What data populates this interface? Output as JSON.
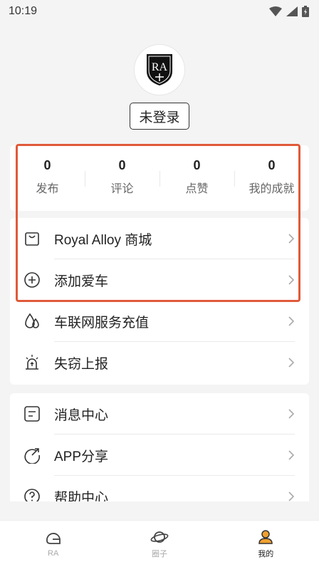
{
  "status_bar": {
    "time": "10:19"
  },
  "profile": {
    "avatar_text": "RA",
    "login_label": "未登录"
  },
  "stats": [
    {
      "value": "0",
      "label": "发布"
    },
    {
      "value": "0",
      "label": "评论"
    },
    {
      "value": "0",
      "label": "点赞"
    },
    {
      "value": "0",
      "label": "我的成就"
    }
  ],
  "menu_group_1": [
    {
      "label": "Royal Alloy 商城",
      "icon": "shopping-bag-icon"
    },
    {
      "label": "添加爱车",
      "icon": "add-circle-icon"
    },
    {
      "label": "车联网服务充值",
      "icon": "drops-icon"
    },
    {
      "label": "失窃上报",
      "icon": "alarm-icon"
    }
  ],
  "menu_group_2": [
    {
      "label": "消息中心",
      "icon": "message-icon"
    },
    {
      "label": "APP分享",
      "icon": "share-icon"
    },
    {
      "label": "帮助中心",
      "icon": "help-icon"
    }
  ],
  "tabs": [
    {
      "label": "RA",
      "icon": "helmet-icon",
      "active": false
    },
    {
      "label": "圈子",
      "icon": "planet-icon",
      "active": false
    },
    {
      "label": "我的",
      "icon": "user-icon",
      "active": true
    }
  ],
  "colors": {
    "highlight": "#e05a3a",
    "background": "#f4f4f4",
    "active_tab_icon": "#f0a030"
  }
}
